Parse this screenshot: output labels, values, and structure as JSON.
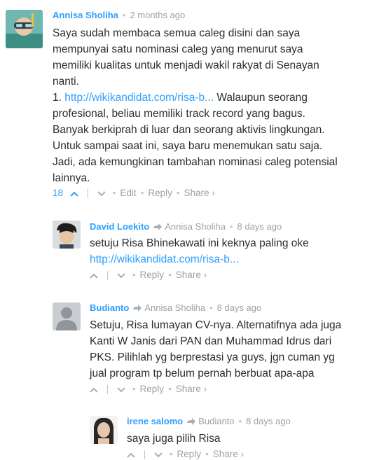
{
  "comments": [
    {
      "author": "Annisa Sholiha",
      "time": "2 months ago",
      "lines": [
        "Saya sudah membaca semua caleg disini dan saya",
        "mempunyai satu nominasi caleg yang menurut saya",
        "memiliki kualitas untuk menjadi wakil rakyat di Senayan",
        "nanti."
      ],
      "list_prefix": "1. ",
      "link": "http://wikikandidat.com/risa-b...",
      "after_link": " Walaupun seorang",
      "lines2": [
        "profesional, beliau memiliki track record yang bagus.",
        "Banyak berkiprah di luar dan seorang aktivis lingkungan.",
        "Untuk sampai saat ini, saya baru menemukan satu saja.",
        "Jadi, ada kemungkinan tambahan nominasi caleg potensial",
        "lainnya."
      ],
      "votes": "18",
      "edit": "Edit",
      "reply": "Reply",
      "share": "Share ›"
    },
    {
      "author": "David Loekito",
      "reply_to": "Annisa Sholiha",
      "time": "8 days ago",
      "line1": "setuju Risa Bhinekawati ini keknya paling oke",
      "link": "http://wikikandidat.com/risa-b...",
      "reply": "Reply",
      "share": "Share ›"
    },
    {
      "author": "Budianto",
      "reply_to": "Annisa Sholiha",
      "time": "8 days ago",
      "lines": [
        "Setuju, Risa lumayan CV-nya. Alternatifnya ada juga",
        "Kanti W Janis dari PAN dan Muhammad Idrus dari",
        "PKS. Pilihlah yg berprestasi ya guys, jgn cuman yg",
        "jual program tp belum pernah berbuat apa-apa"
      ],
      "reply": "Reply",
      "share": "Share ›"
    },
    {
      "author": "irene salomo",
      "reply_to": "Budianto",
      "time": "8 days ago",
      "line1": "saya juga pilih Risa",
      "reply": "Reply",
      "share": "Share ›"
    }
  ],
  "colors": {
    "accent": "#2e9fff",
    "muted": "#9aa3a6",
    "text": "#2a2e2e"
  }
}
